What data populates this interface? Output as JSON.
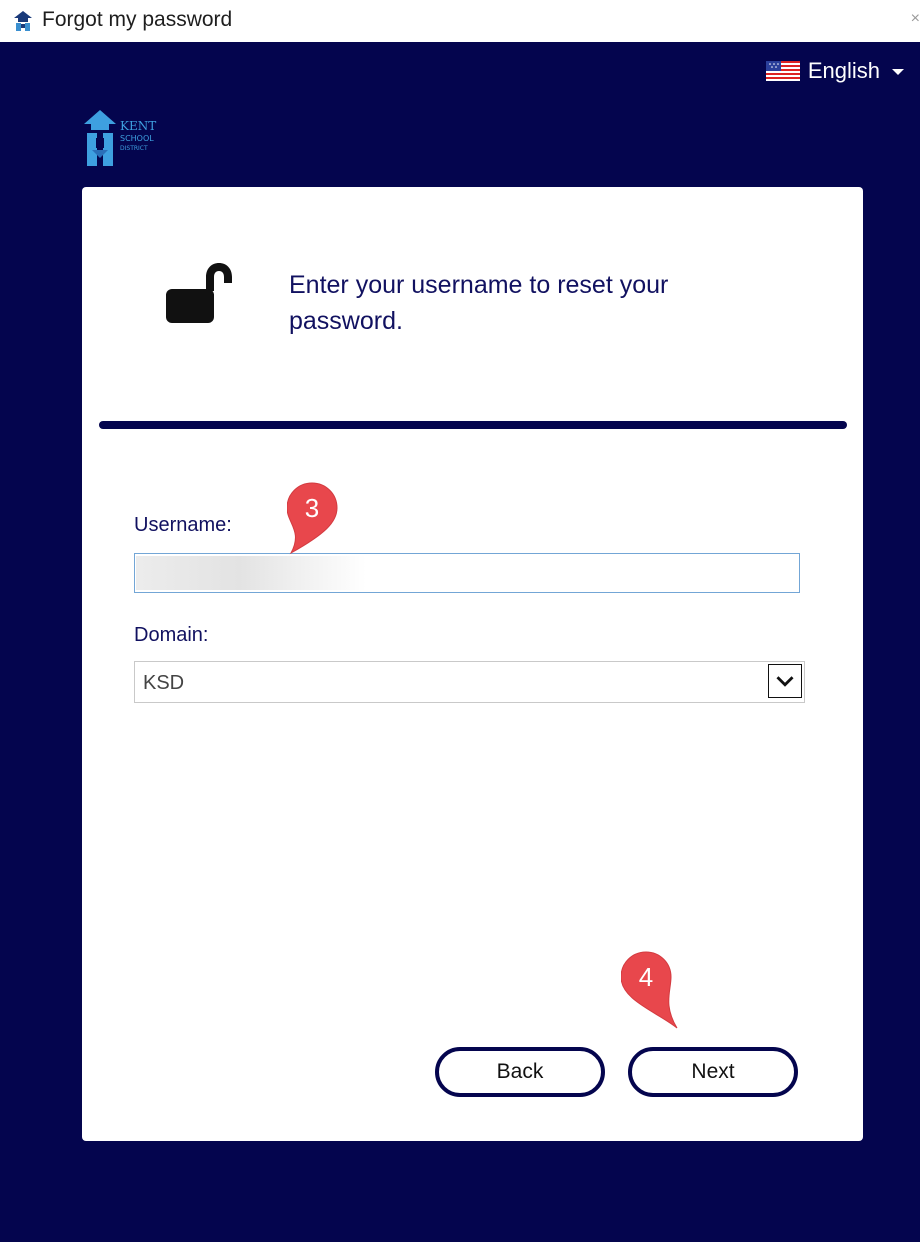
{
  "window": {
    "title": "Forgot my password",
    "close_glyph": "×"
  },
  "language": {
    "selected": "English",
    "flag_icon": "us-flag-icon"
  },
  "logo": {
    "lines": [
      "KENT",
      "SCHOOL",
      "DISTRICT"
    ]
  },
  "card": {
    "heading": "Enter your username to reset your password.",
    "icon": "unlocked-padlock-icon"
  },
  "form": {
    "username_label": "Username:",
    "username_value": "",
    "domain_label": "Domain:",
    "domain_selected": "KSD"
  },
  "buttons": {
    "back_label": "Back",
    "next_label": "Next"
  },
  "annotations": {
    "step_username": "3",
    "step_next": "4"
  },
  "colors": {
    "background": "#04054e",
    "accent_text": "#111160",
    "marker": "#e8474c"
  }
}
